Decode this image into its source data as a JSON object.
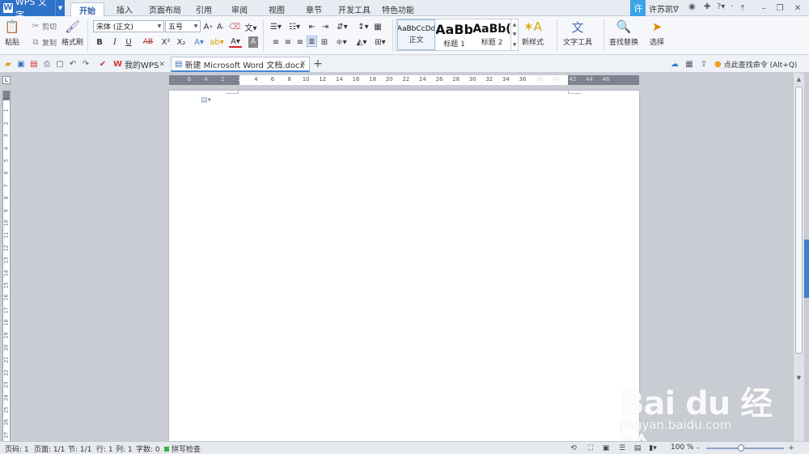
{
  "app": {
    "name": "WPS 文字"
  },
  "ribbon_tabs": [
    "开始",
    "插入",
    "页面布局",
    "引用",
    "审阅",
    "视图",
    "章节",
    "开发工具",
    "特色功能"
  ],
  "user": {
    "avatar_char": "许",
    "name": "许苏凯∇"
  },
  "clipboard": {
    "paste": "粘贴",
    "cut": "剪切",
    "copy": "复制",
    "format_painter": "格式刷"
  },
  "font": {
    "family": "宋体 (正文)",
    "size": "五号"
  },
  "format_glyphs": {
    "bold": "B",
    "italic": "I",
    "underline": "U",
    "strike": "AB",
    "superscript": "X²",
    "subscript": "X₂"
  },
  "styles": [
    {
      "sample": "AaBbCcDd",
      "label": "正文"
    },
    {
      "sample": "AaBb",
      "label": "标题 1"
    },
    {
      "sample": "AaBb(",
      "label": "标题 2"
    }
  ],
  "ribbon_buttons": {
    "new_style": "新样式",
    "text_tools": "文字工具",
    "find_replace": "查找替换",
    "select": "选择"
  },
  "doc_tabs": [
    {
      "label": "我的WPS"
    },
    {
      "label": "新建 Microsoft Word 文档.docx"
    }
  ],
  "find_command": "点此查找命令 (Alt+Q)",
  "ruler_h": [
    "6",
    "4",
    "2",
    "2",
    "4",
    "6",
    "8",
    "10",
    "12",
    "14",
    "16",
    "18",
    "20",
    "22",
    "24",
    "26",
    "28",
    "30",
    "32",
    "34",
    "36",
    "38",
    "40",
    "42",
    "44",
    "46"
  ],
  "ruler_v": [
    "1",
    "1",
    "2",
    "3",
    "4",
    "5",
    "6",
    "7",
    "8",
    "9",
    "10",
    "11",
    "12",
    "13",
    "14",
    "15",
    "16",
    "17",
    "18",
    "19",
    "20",
    "21",
    "22",
    "23",
    "24",
    "25",
    "26",
    "27"
  ],
  "status": {
    "page_no": "页码: 1",
    "pages": "页面: 1/1",
    "section": "节: 1/1",
    "row": "行: 1",
    "col": "列: 1",
    "words": "字数: 0",
    "spell": "拼写检查",
    "zoom": "100 %",
    "zoom_fraction": 0.45
  },
  "watermark": {
    "text": "Bai du 经验",
    "url": "jingyan.baidu.com"
  },
  "icons": {
    "paste": "clipboard-icon",
    "cut": "scissors-icon",
    "copy": "copy-icon",
    "painter": "brush-icon",
    "search": "search-icon",
    "select": "cursor-icon",
    "new_style": "style-icon",
    "text_tools": "text-tools-icon"
  },
  "colors": {
    "accent": "#2f72c9",
    "ribbon_bg": "#f5f7fa",
    "workspace": "#c9ccd3",
    "user_badge": "#3ba3e8"
  }
}
